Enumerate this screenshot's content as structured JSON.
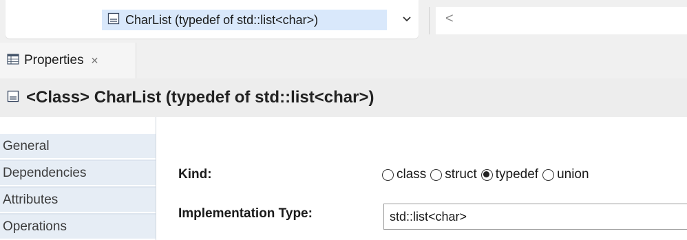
{
  "breadcrumb": {
    "label": "CharList (typedef of std::list<char>)",
    "nav_back_glyph": "<",
    "icons": {
      "element": "typedef-element-icon",
      "dropdown": "chevron-down-icon"
    }
  },
  "tab": {
    "label": "Properties",
    "close_glyph": "✕",
    "icon": "properties-view-icon"
  },
  "header": {
    "title": "<Class> CharList (typedef of std::list<char>)",
    "icon": "typedef-element-icon"
  },
  "sidebar": {
    "items": [
      {
        "label": "General"
      },
      {
        "label": "Dependencies"
      },
      {
        "label": "Attributes"
      },
      {
        "label": "Operations"
      }
    ]
  },
  "form": {
    "kind": {
      "label": "Kind:",
      "options": [
        {
          "label": "class",
          "selected": false
        },
        {
          "label": "struct",
          "selected": false
        },
        {
          "label": "typedef",
          "selected": true
        },
        {
          "label": "union",
          "selected": false
        }
      ]
    },
    "implementation_type": {
      "label": "Implementation Type:",
      "value": "std::list<char>"
    }
  },
  "colors": {
    "selection": "#d9e8fb",
    "sidebar_item": "#e6edf5",
    "header_bg": "#ededed",
    "chrome_bg": "#f0f0f0"
  }
}
